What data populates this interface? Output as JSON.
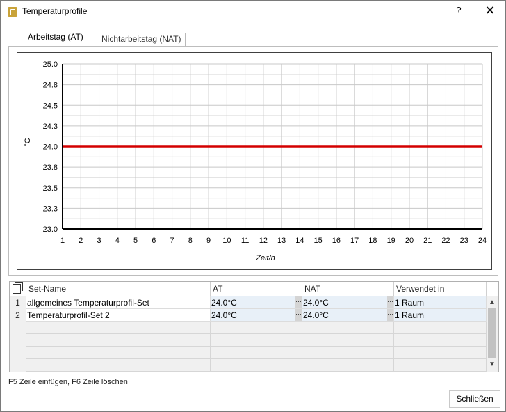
{
  "window": {
    "title": "Temperaturprofile",
    "help_label": "?",
    "close_label": "✕"
  },
  "tabs": [
    {
      "label": "Arbeitstag (AT)",
      "active": true
    },
    {
      "label": "Nichtarbeitstag (NAT)",
      "active": false
    }
  ],
  "chart_data": {
    "type": "line",
    "xlabel": "Zeit/h",
    "ylabel": "°C",
    "xlim": [
      1,
      24
    ],
    "ylim": [
      23.0,
      25.0
    ],
    "x_ticks": [
      "1",
      "2",
      "3",
      "4",
      "5",
      "6",
      "7",
      "8",
      "9",
      "10",
      "11",
      "12",
      "13",
      "14",
      "15",
      "16",
      "17",
      "18",
      "19",
      "20",
      "21",
      "22",
      "23",
      "24"
    ],
    "y_ticks": [
      "23.0",
      "23.3",
      "23.5",
      "23.8",
      "24.0",
      "24.3",
      "24.5",
      "24.8",
      "25.0"
    ],
    "y_tick_values": [
      23.0,
      23.25,
      23.5,
      23.75,
      24.0,
      24.25,
      24.5,
      24.75,
      25.0
    ],
    "grid": true,
    "series": [
      {
        "color": "#d40000",
        "x": [
          1,
          24
        ],
        "y": [
          24.0,
          24.0
        ]
      }
    ]
  },
  "table": {
    "columns": [
      "Set-Name",
      "AT",
      "NAT",
      "Verwendet in"
    ],
    "rows": [
      {
        "num": "1",
        "name": "allgemeines Temperaturprofil-Set",
        "at": "24.0°C",
        "nat": "24.0°C",
        "used": "1 Raum"
      },
      {
        "num": "2",
        "name": "Temperaturprofil-Set 2",
        "at": "24.0°C",
        "nat": "24.0°C",
        "used": "1 Raum"
      }
    ],
    "ellipsis": "···",
    "scroll_up": "▲",
    "scroll_down": "▼"
  },
  "hint": "F5 Zeile einfügen, F6 Zeile löschen",
  "close_button": "Schließen"
}
